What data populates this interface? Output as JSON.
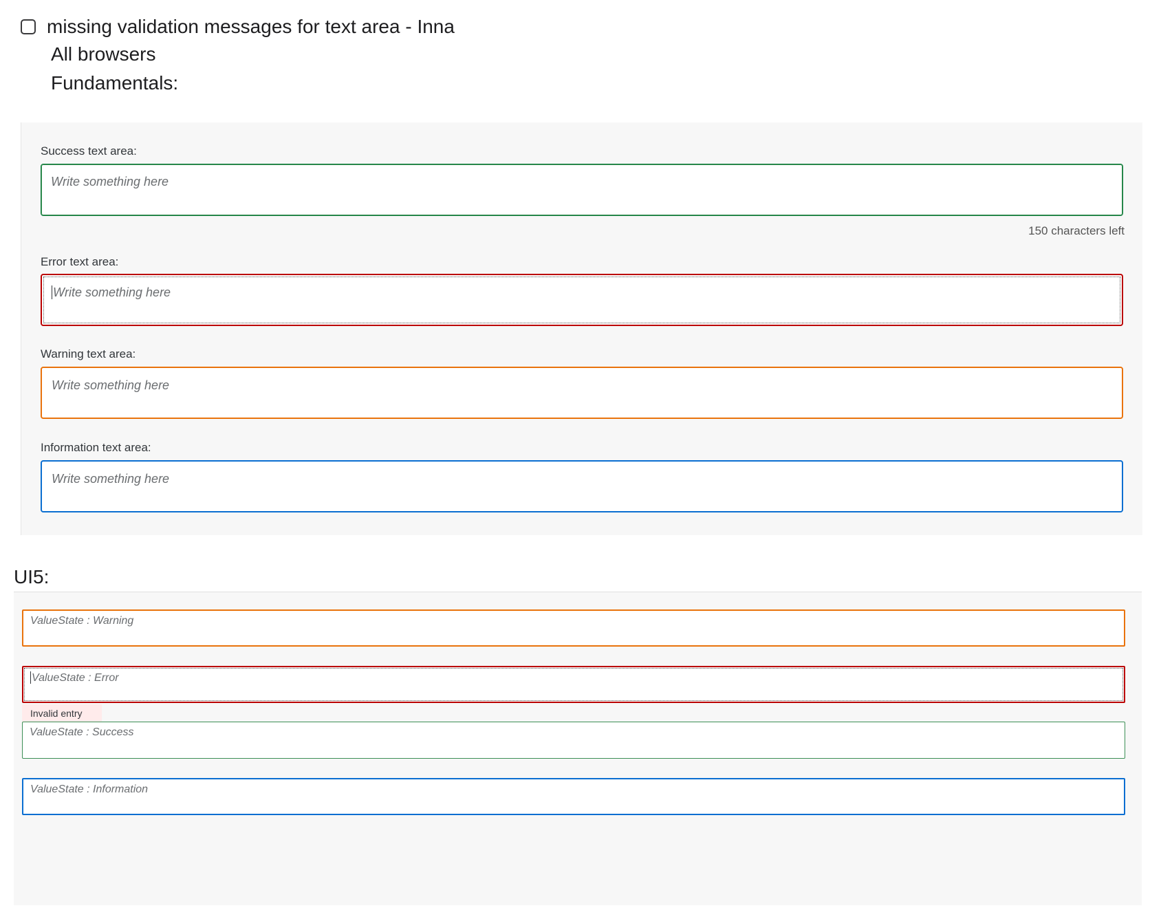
{
  "task": {
    "title": "missing validation messages for text area - Inna",
    "browsers": "All browsers",
    "section": "Fundamentals:"
  },
  "fundamentals": {
    "success": {
      "label": "Success text area:",
      "placeholder": "Write something here",
      "counter": "150 characters left"
    },
    "error": {
      "label": "Error text area:",
      "placeholder": "Write something here"
    },
    "warning": {
      "label": "Warning text area:",
      "placeholder": "Write something here"
    },
    "information": {
      "label": "Information text area:",
      "placeholder": "Write something here"
    }
  },
  "ui5": {
    "heading": "UI5:",
    "warning_placeholder": "ValueState : Warning",
    "error_placeholder": "ValueState : Error",
    "error_message": "Invalid entry",
    "success_placeholder": "ValueState : Success",
    "information_placeholder": "ValueState : Information"
  },
  "colors": {
    "success": "#107e3e",
    "error": "#bb0000",
    "warning": "#e9730c",
    "information": "#0a6ed1"
  }
}
